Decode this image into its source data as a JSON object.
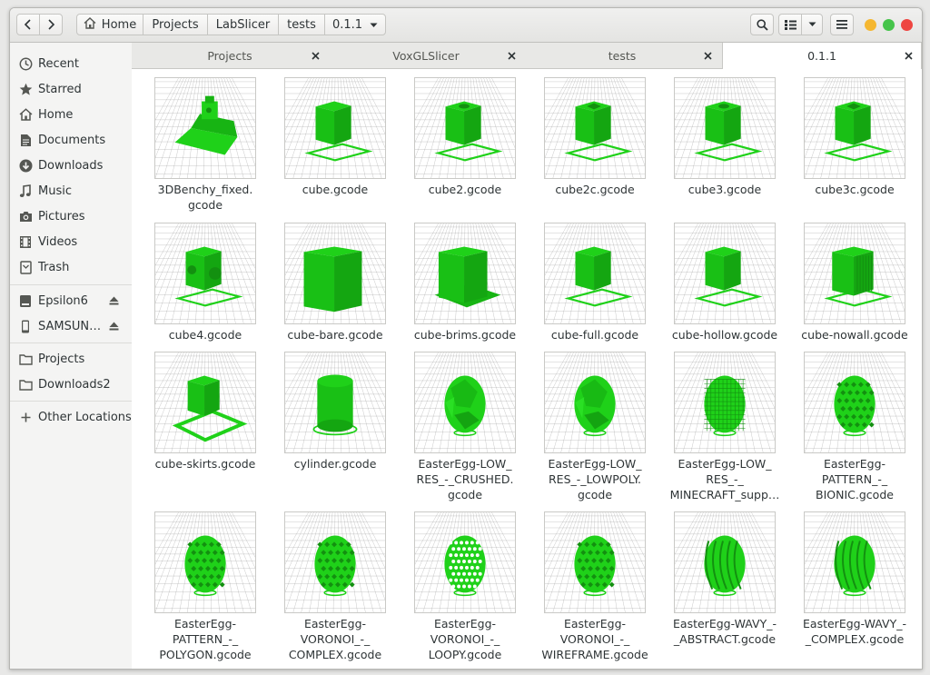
{
  "headerbar": {
    "back_icon": "chevron-left-icon",
    "forward_icon": "chevron-right-icon",
    "breadcrumbs": [
      "Home",
      "Projects",
      "LabSlicer",
      "tests",
      "0.1.1"
    ],
    "search_icon": "search-icon",
    "view_icon": "grid-view-icon",
    "view_menu_icon": "chevron-down-icon",
    "menu_icon": "hamburger-icon",
    "window_controls": {
      "minimize": "#f5b731",
      "maximize": "#46c44b",
      "close": "#ee4540"
    }
  },
  "sidebar": {
    "items": [
      {
        "label": "Recent",
        "icon": "clock-icon"
      },
      {
        "label": "Starred",
        "icon": "star-icon"
      },
      {
        "label": "Home",
        "icon": "home-icon"
      },
      {
        "label": "Documents",
        "icon": "document-icon"
      },
      {
        "label": "Downloads",
        "icon": "download-icon"
      },
      {
        "label": "Music",
        "icon": "music-icon"
      },
      {
        "label": "Pictures",
        "icon": "camera-icon"
      },
      {
        "label": "Videos",
        "icon": "film-icon"
      },
      {
        "label": "Trash",
        "icon": "trash-icon"
      }
    ],
    "devices": [
      {
        "label": "Epsilon6",
        "icon": "drive-icon"
      },
      {
        "label": "SAMSUN…",
        "icon": "phone-icon"
      }
    ],
    "bookmarks": [
      {
        "label": "Projects",
        "icon": "folder-icon"
      },
      {
        "label": "Downloads2",
        "icon": "folder-icon"
      }
    ],
    "other": {
      "label": "Other Locations",
      "icon": "plus-icon"
    }
  },
  "tabs": [
    {
      "label": "Projects",
      "active": false
    },
    {
      "label": "VoxGLSlicer",
      "active": false
    },
    {
      "label": "tests",
      "active": false
    },
    {
      "label": "0.1.1",
      "active": true
    }
  ],
  "files": [
    {
      "name": "3DBenchy_fixed.\ngcode",
      "shape": "benchy"
    },
    {
      "name": "cube.gcode",
      "shape": "cube"
    },
    {
      "name": "cube2.gcode",
      "shape": "cube-hole"
    },
    {
      "name": "cube2c.gcode",
      "shape": "cube-square"
    },
    {
      "name": "cube3.gcode",
      "shape": "cube-hole"
    },
    {
      "name": "cube3c.gcode",
      "shape": "cube-square"
    },
    {
      "name": "cube4.gcode",
      "shape": "cube-side"
    },
    {
      "name": "cube-bare.gcode",
      "shape": "cube-bare"
    },
    {
      "name": "cube-brims.gcode",
      "shape": "cube-brims"
    },
    {
      "name": "cube-full.gcode",
      "shape": "cube"
    },
    {
      "name": "cube-hollow.gcode",
      "shape": "cube"
    },
    {
      "name": "cube-nowall.gcode",
      "shape": "cube-nowall"
    },
    {
      "name": "cube-skirts.gcode",
      "shape": "cube-skirts"
    },
    {
      "name": "cylinder.gcode",
      "shape": "cylinder"
    },
    {
      "name": "EasterEgg-LOW_\nRES_-_CRUSHED.\ngcode",
      "shape": "egg-crushed"
    },
    {
      "name": "EasterEgg-LOW_\nRES_-_LOWPOLY.\ngcode",
      "shape": "egg-poly"
    },
    {
      "name": "EasterEgg-LOW_\nRES_-_\nMINECRAFT_supp…",
      "shape": "egg-voxel"
    },
    {
      "name": "EasterEgg-\nPATTERN_-_\nBIONIC.gcode",
      "shape": "egg-pattern"
    },
    {
      "name": "EasterEgg-\nPATTERN_-_\nPOLYGON.gcode",
      "shape": "egg-pattern"
    },
    {
      "name": "EasterEgg-\nVORONOI_-_\nCOMPLEX.gcode",
      "shape": "egg-voronoi"
    },
    {
      "name": "EasterEgg-\nVORONOI_-_\nLOOPY.gcode",
      "shape": "egg-loopy"
    },
    {
      "name": "EasterEgg-\nVORONOI_-_\nWIREFRAME.gcode",
      "shape": "egg-pattern"
    },
    {
      "name": "EasterEgg-WAVY_-\n_ABSTRACT.gcode",
      "shape": "egg-wavy"
    },
    {
      "name": "EasterEgg-WAVY_-\n_COMPLEX.gcode",
      "shape": "egg-wavy2"
    }
  ],
  "colors": {
    "accent_green": "#1fd119",
    "dark_green": "#139010"
  }
}
